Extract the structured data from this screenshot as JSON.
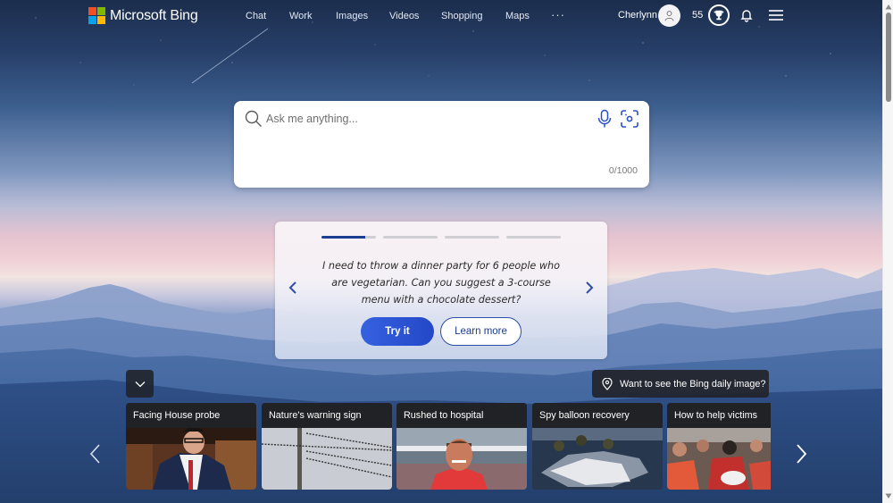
{
  "brand": {
    "name": "Microsoft Bing",
    "logo_colors": [
      "#f25022",
      "#7fba00",
      "#00a4ef",
      "#ffb900"
    ]
  },
  "nav": {
    "items": [
      {
        "label": "Chat"
      },
      {
        "label": "Work"
      },
      {
        "label": "Images"
      },
      {
        "label": "Videos"
      },
      {
        "label": "Shopping"
      },
      {
        "label": "Maps"
      }
    ],
    "more_label": "···"
  },
  "user": {
    "name": "Cherlynn",
    "points": "55",
    "avatar_icon": "person-icon",
    "rewards_icon": "trophy-icon",
    "notifications_icon": "bell-icon",
    "menu_icon": "hamburger-menu-icon"
  },
  "search": {
    "placeholder": "Ask me anything...",
    "value": "",
    "char_count": "0/1000",
    "icons": [
      "search-icon",
      "microphone-icon",
      "visual-search-icon"
    ]
  },
  "suggestion_card": {
    "progress": {
      "total_steps": 4,
      "current_step": 1,
      "current_step_fill": 0.8
    },
    "text": "I need to throw a dinner party for 6 people who are vegetarian. Can you suggest a 3-course menu with a chocolate dessert?",
    "try_label": "Try it",
    "learn_label": "Learn more",
    "accent_color": "#2a4fd0"
  },
  "daily_image": {
    "label": "Want to see the Bing daily image?"
  },
  "news": {
    "items": [
      {
        "title": "Facing House probe"
      },
      {
        "title": "Nature's warning sign"
      },
      {
        "title": "Rushed to hospital"
      },
      {
        "title": "Spy balloon recovery"
      },
      {
        "title": "How to help victims"
      }
    ]
  }
}
